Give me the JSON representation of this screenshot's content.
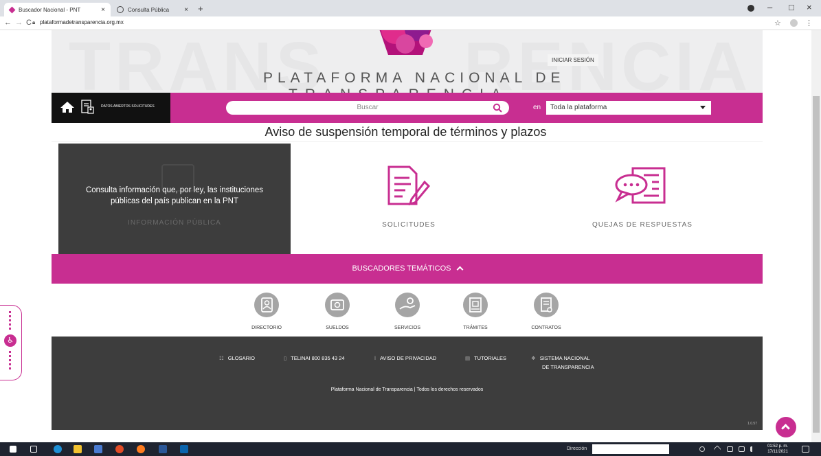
{
  "browser": {
    "tabs": [
      {
        "title": "Buscador Nacional - PNT",
        "active": true,
        "close": "×"
      },
      {
        "title": "Consulta Pública",
        "active": false,
        "close": "×"
      }
    ],
    "new_tab": "+",
    "url": "plataformadetransparencia.org.mx",
    "window_controls": [
      "–",
      "□",
      "×"
    ]
  },
  "banner": {
    "title_line1": "PLATAFORMA NACIONAL DE",
    "title_line2": "TRANSPARENCIA",
    "login_label": "INICIAR SESIÓN",
    "watermark_left": "TRANS",
    "watermark_right": "RENCIA"
  },
  "searchbar": {
    "datos_label": "DATOS ABIERTOS SOLICITUDES",
    "search_placeholder": "Buscar",
    "in_label": "en",
    "scope_value": "Toda la plataforma"
  },
  "notice": "Aviso de suspensión temporal de términos y plazos",
  "cards": {
    "info_desc": "Consulta información que, por ley, las instituciones públicas del país publican en la PNT",
    "info_title": "INFORMACIÓN PÚBLICA",
    "solicitudes_title": "SOLICITUDES",
    "quejas_title": "QUEJAS DE RESPUESTAS"
  },
  "thematic": {
    "label": "BUSCADORES TEMÁTICOS",
    "items": [
      "DIRECTORIO",
      "SUELDOS",
      "SERVICIOS",
      "TRÁMITES",
      "CONTRATOS"
    ]
  },
  "footer": {
    "links": [
      "GLOSARIO",
      "TELINAI 800 835 43 24",
      "AVISO DE PRIVACIDAD",
      "TUTORIALES",
      "SISTEMA NACIONAL",
      "DE TRANSPARENCIA"
    ],
    "copyright": "Plataforma Nacional de Transparencia | Todos los derechos reservados",
    "version": "1.0.57"
  },
  "taskbar": {
    "address_label": "Dirección",
    "time": "01:52 p. m.",
    "date": "17/11/2021"
  },
  "colors": {
    "brand": "#c82e91",
    "dark": "#3d3d3d"
  }
}
